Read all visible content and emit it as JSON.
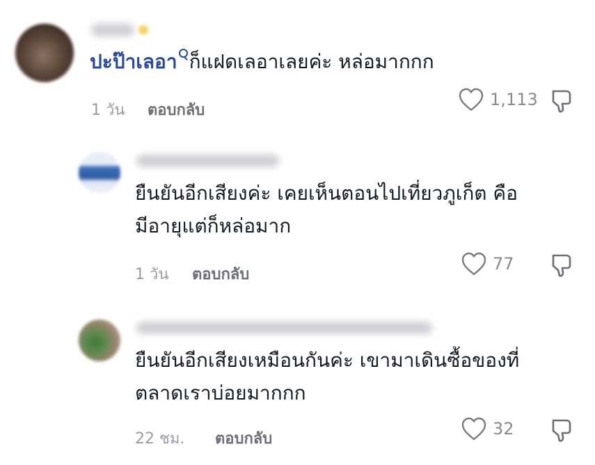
{
  "comments": [
    {
      "mention": "ปะป๊าเลอา",
      "text": "ก็แฝดเลอาเลยค่ะ หล่อมากกก",
      "time": "1 วัน",
      "reply": "ตอบกลับ",
      "likes": "1,113"
    },
    {
      "line1": "ยืนยันอีกเสียงค่ะ เคยเห็นตอนไปเที่ยวภูเก็ต คือ",
      "line2": "มีอายุแต่ก็หล่อมาก",
      "time": "1 วัน",
      "reply": "ตอบกลับ",
      "likes": "77"
    },
    {
      "line1": "ยืนยันอีกเสียงเหมือนกันค่ะ เขามาเดินซื้อของที่",
      "line2": "ตลาดเราบ่อยมากกก",
      "time": "22 ชม.",
      "reply": "ตอบกลับ",
      "likes": "32"
    }
  ],
  "icons": {
    "like": "heart-outline-icon",
    "dislike": "thumbs-down-icon"
  },
  "colors": {
    "mention": "#2b4a9b",
    "text": "#161823",
    "meta": "#9b9ba3"
  }
}
